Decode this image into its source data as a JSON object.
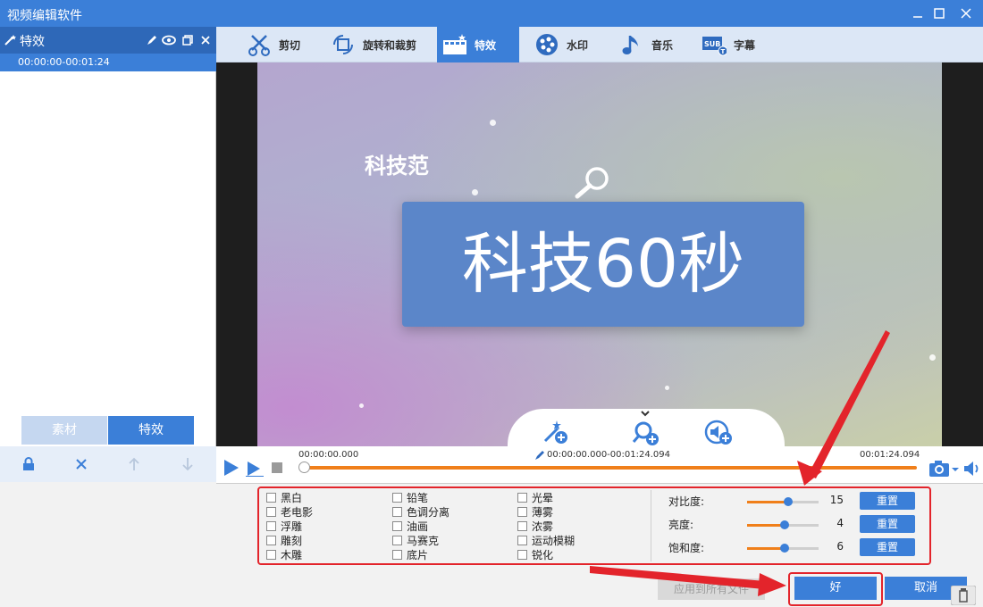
{
  "window": {
    "title": "视频编辑软件"
  },
  "left_panel": {
    "header": "特效",
    "item_time": "00:00:00-00:01:24",
    "tabs": [
      {
        "label": "素材"
      },
      {
        "label": "特效"
      }
    ]
  },
  "toolbar": {
    "tools": [
      {
        "label": "剪切",
        "icon": "scissors-icon"
      },
      {
        "label": "旋转和裁剪",
        "icon": "crop-rotate-icon"
      },
      {
        "label": "特效",
        "icon": "effects-film-icon"
      },
      {
        "label": "水印",
        "icon": "watermark-icon"
      },
      {
        "label": "音乐",
        "icon": "music-note-icon"
      },
      {
        "label": "字幕",
        "icon": "subtitle-icon"
      }
    ]
  },
  "video": {
    "brand_text": "科技范",
    "title_text": "科技60秒"
  },
  "timeline": {
    "start": "00:00:00.000",
    "range": "00:00:00.000-00:01:24.094",
    "end": "00:01:24.094"
  },
  "effects": {
    "col1": [
      "黑白",
      "老电影",
      "浮雕",
      "雕刻",
      "木雕"
    ],
    "col2": [
      "铅笔",
      "色调分离",
      "油画",
      "马赛克",
      "底片"
    ],
    "col3": [
      "光晕",
      "薄雾",
      "浓雾",
      "运动模糊",
      "锐化"
    ]
  },
  "adjustments": {
    "reset_label": "重置",
    "items": [
      {
        "label": "对比度:",
        "value": "15",
        "level": 0.57
      },
      {
        "label": "亮度:",
        "value": "4",
        "level": 0.52
      },
      {
        "label": "饱和度:",
        "value": "6",
        "level": 0.53
      }
    ]
  },
  "buttons": {
    "apply_all": "应用到所有文件",
    "ok": "好",
    "cancel": "取消"
  },
  "colors": {
    "accent": "#3b7fd8",
    "highlight": "#e3242b",
    "progress": "#f07f1a"
  }
}
